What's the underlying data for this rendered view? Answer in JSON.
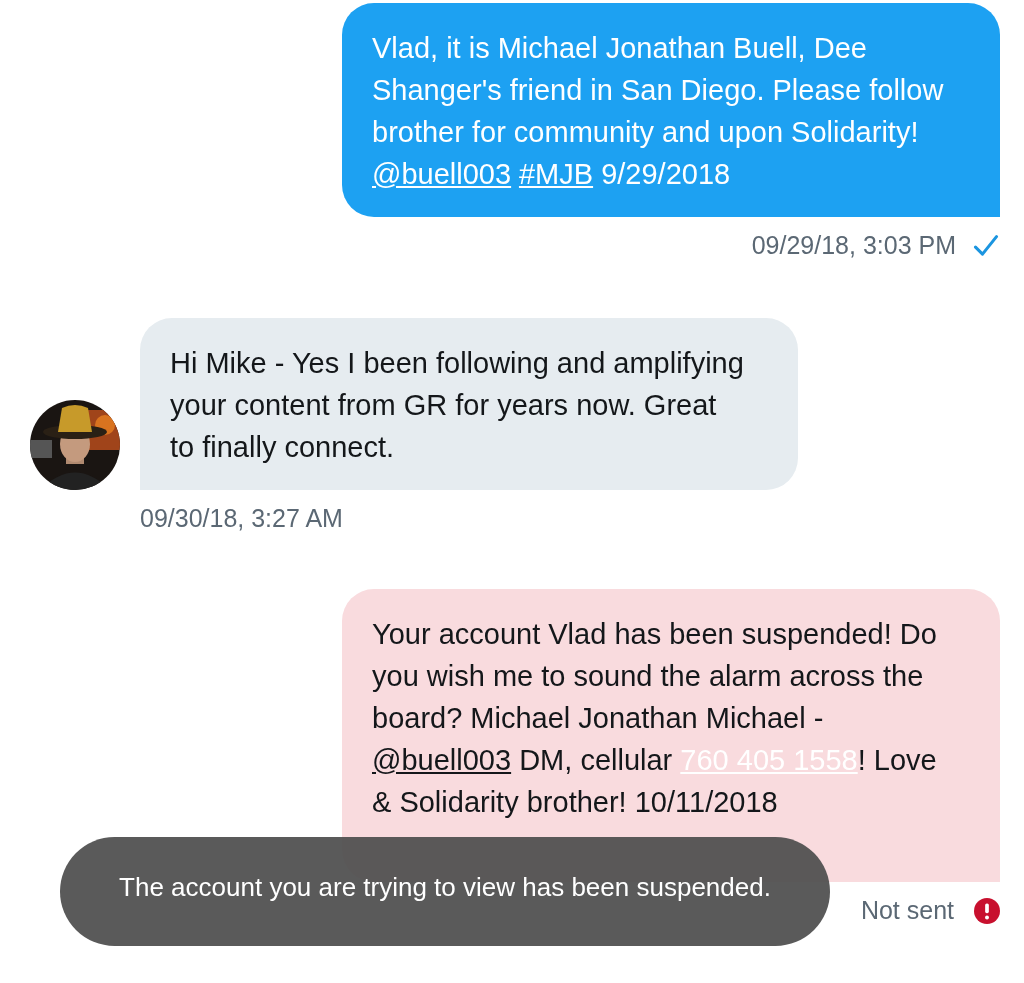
{
  "messages": [
    {
      "kind": "sent",
      "segments": [
        {
          "kind": "text",
          "text": "Vlad, it is Michael Jonathan Buell, Dee Shanger's friend in San Diego. Please follow brother for community and upon Solidarity! "
        },
        {
          "kind": "link",
          "text": "@buell003"
        },
        {
          "kind": "link",
          "text": "#MJB"
        },
        {
          "kind": "text",
          "text": " 9/29/2018"
        }
      ],
      "time": "09/29/18, 3:03 PM"
    },
    {
      "kind": "received",
      "segments": [
        {
          "kind": "text",
          "text": "Hi Mike - Yes I been following and amplifying your content from GR for years now.  Great to finally connect."
        }
      ],
      "time": "09/30/18, 3:27 AM"
    },
    {
      "kind": "failed",
      "segments": [
        {
          "kind": "text",
          "text": "Your account Vlad has been suspended! Do you wish me to sound the alarm across the board? Michael Jonathan Michael - "
        },
        {
          "kind": "link",
          "text": "@buell003"
        },
        {
          "kind": "text",
          "text": " DM, cellular "
        },
        {
          "kind": "phone",
          "text": "760 405 1558"
        },
        {
          "kind": "text",
          "text": "! Love & Solidarity brother! 10/11/2018"
        }
      ],
      "status_text": "Not sent"
    }
  ],
  "toast": {
    "text": "The account you are trying to view has been suspended."
  }
}
